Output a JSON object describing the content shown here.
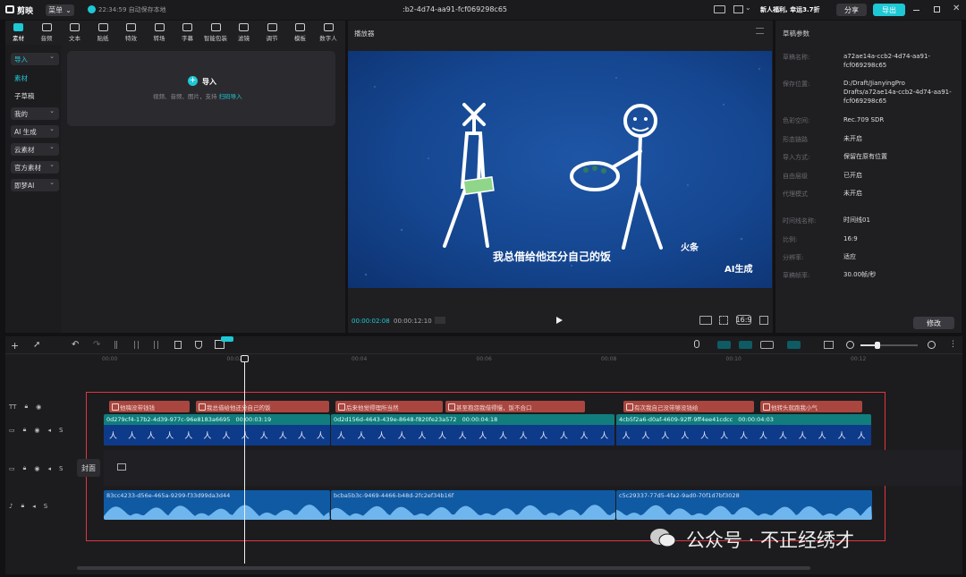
{
  "app": {
    "name": "剪映",
    "menu": "菜单",
    "autosave": "22:34:59 自动保存本地",
    "title": ":b2-4d74-aa91-fcf069298c65",
    "promo": "新人福利, 幸运3.7折",
    "share": "分享",
    "export": "导出"
  },
  "toolbar": [
    {
      "label": "素材",
      "icon": "media-icon"
    },
    {
      "label": "音频",
      "icon": "audio-icon"
    },
    {
      "label": "文本",
      "icon": "text-icon"
    },
    {
      "label": "贴纸",
      "icon": "sticker-icon"
    },
    {
      "label": "特效",
      "icon": "effects-icon"
    },
    {
      "label": "转场",
      "icon": "transition-icon"
    },
    {
      "label": "字幕",
      "icon": "subtitle-icon"
    },
    {
      "label": "智能包装",
      "icon": "smart-pack-icon"
    },
    {
      "label": "滤镜",
      "icon": "filter-icon"
    },
    {
      "label": "调节",
      "icon": "adjust-icon"
    },
    {
      "label": "模板",
      "icon": "template-icon"
    },
    {
      "label": "数字人",
      "icon": "avatar-icon"
    }
  ],
  "sidebar": [
    {
      "label": "导入",
      "box": true,
      "active": true
    },
    {
      "label": "素材",
      "box": false,
      "active": true
    },
    {
      "label": "子草稿",
      "box": false,
      "active": false
    },
    {
      "label": "我的",
      "box": true,
      "active": false
    },
    {
      "label": "AI 生成",
      "box": true,
      "active": false
    },
    {
      "label": "云素材",
      "box": true,
      "active": false
    },
    {
      "label": "官方素材",
      "box": true,
      "active": false
    },
    {
      "label": "即梦AI",
      "box": true,
      "active": false
    }
  ],
  "import": {
    "button": "导入",
    "hint": "视频、音频、图片，支持",
    "hint_link": "扫码导入"
  },
  "player": {
    "title": "播放器",
    "subtitle": "我总借给他还分自己的饭",
    "watermark1": "火条",
    "watermark2": "AI生成",
    "current_time": "00:00:02:08",
    "total_time": "00:00:12:10",
    "ratio_btn": "16:9"
  },
  "props": {
    "title": "草稿参数",
    "rows": [
      {
        "k": "草稿名称:",
        "v": "a72ae14a-ccb2-4d74-aa91-fcf069298c65"
      },
      {
        "k": "保存位置:",
        "v": "D:/Draft/JianyingPro Drafts/a72ae14a-ccb2-4d74-aa91-fcf069298c65"
      },
      {
        "k": "色彩空间:",
        "v": "Rec.709 SDR"
      },
      {
        "k": "形态链路",
        "v": "未开启"
      },
      {
        "k": "导入方式:",
        "v": "保留在原有位置"
      },
      {
        "k": "自由层级",
        "v": "已开启"
      },
      {
        "k": "代理模式",
        "v": "未开启"
      },
      {
        "k": "时间线名称:",
        "v": "时间线01"
      },
      {
        "k": "比例:",
        "v": "16:9"
      },
      {
        "k": "分辨率:",
        "v": "适应"
      },
      {
        "k": "草稿帧率:",
        "v": "30.00帧/秒"
      }
    ],
    "modify": "修改"
  },
  "timeline": {
    "ruler": [
      "00:00",
      "00:02",
      "00:04",
      "00:06",
      "00:08",
      "00:10",
      "00:12"
    ],
    "text_clips": [
      "他嗨没带钱钱",
      "我总借给他还分自己的饭",
      "后来他觉得理所当然",
      "甚至抱怨我借得慢，饭不合口",
      "有次我自己没带够没钱给",
      "他转头就跑我小气"
    ],
    "video_clips": [
      {
        "id": "0d279cf4-17b2-4d39-977c-96e8183a6695",
        "dur": "00:00:03:19"
      },
      {
        "id": "0d2d156d-4643-439e-8648-f820fe23a572",
        "dur": "00:00:04:18"
      },
      {
        "id": "4cb5f2a6-d0af-4609-92ff-9ff4ee41cdcc",
        "dur": "00:00:04:03"
      }
    ],
    "audio_clips": [
      "83cc4233-d56e-465a-9299-f33d99da3d44",
      "bcba5b3c-9469-4466-b48d-2fc2ef34b16f",
      "c5c29337-77d5-4fa2-9ad0-70f1d7bf3028"
    ],
    "cover": "封面"
  },
  "watermark": "公众号 · 不正经绣才"
}
